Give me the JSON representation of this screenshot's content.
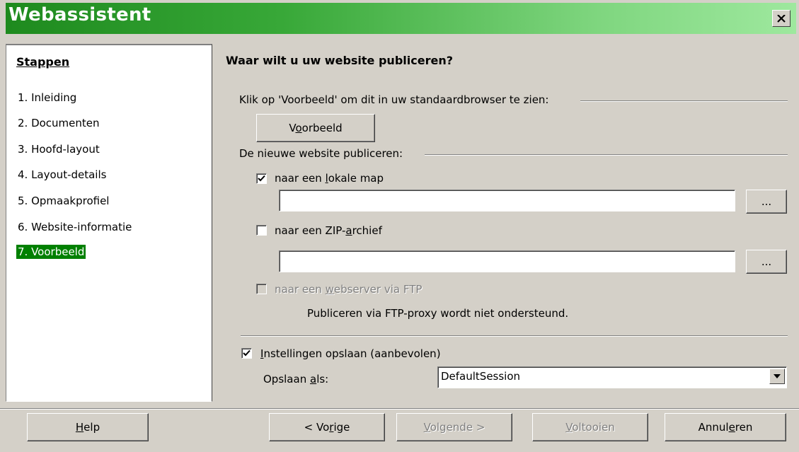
{
  "window": {
    "title": "Webassistent",
    "close_icon": "close-icon"
  },
  "sidebar": {
    "heading": "Stappen",
    "steps": [
      {
        "label": "1. Inleiding"
      },
      {
        "label": "2. Documenten"
      },
      {
        "label": "3. Hoofd-layout"
      },
      {
        "label": "4. Layout-details"
      },
      {
        "label": "5. Opmaakprofiel"
      },
      {
        "label": "6. Website-informatie"
      },
      {
        "label": "7. Voorbeeld",
        "active": true
      }
    ]
  },
  "main": {
    "title": "Waar wilt u uw website publiceren?",
    "preview_group_label": "Klik op 'Voorbeeld' om dit in uw standaardbrowser te zien:",
    "preview_button": {
      "label": "Voorbeeld",
      "mnemonic_index": 1
    },
    "publish_group_label": "De nieuwe website publiceren:",
    "local_folder": {
      "label": "naar een lokale map",
      "checked": true,
      "path_value": "",
      "browse_label": "..."
    },
    "zip_archive": {
      "label": "naar een ZIP-archief",
      "checked": false,
      "path_value": "",
      "browse_label": "..."
    },
    "ftp": {
      "label": "naar een webserver via FTP",
      "checked": false,
      "disabled": true,
      "note": "Publiceren via FTP-proxy wordt niet ondersteund."
    },
    "save_settings": {
      "label": "Instellingen opslaan (aanbevolen)",
      "checked": true
    },
    "save_as": {
      "label": "Opslaan als:",
      "value": "DefaultSession"
    }
  },
  "footer": {
    "help": "Help",
    "back": "< Vorige",
    "next": "Volgende >",
    "finish": "Voltooien",
    "cancel": "Annuleren"
  },
  "colors": {
    "titlebar_start": "#1e8a1e",
    "titlebar_end": "#9ee89e",
    "active_step": "#008000",
    "dialog_bg": "#d4d0c8"
  }
}
